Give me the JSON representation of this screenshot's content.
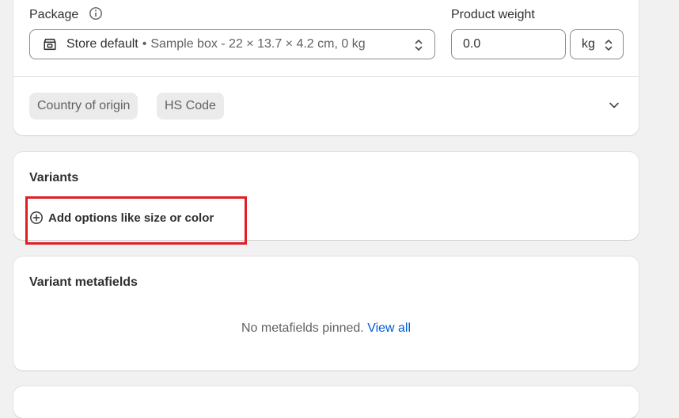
{
  "shipping": {
    "package_label": "Package",
    "package_select": {
      "main": "Store default",
      "separator": "•",
      "detail": "Sample box - 22 × 13.7 × 4.2 cm, 0 kg"
    },
    "weight_label": "Product weight",
    "weight_value": "0.0",
    "weight_unit": "kg",
    "chips": [
      "Country of origin",
      "HS Code"
    ]
  },
  "variants": {
    "title": "Variants",
    "add_options_label": "Add options like size or color"
  },
  "metafields": {
    "title": "Variant metafields",
    "empty_text": "No metafields pinned.",
    "view_all_label": "View all"
  },
  "colors": {
    "link": "#005bd3",
    "highlight": "#e01e26"
  },
  "icons": [
    "info-icon",
    "package-box-icon",
    "updown-arrows-icon",
    "chevron-down-icon",
    "plus-circle-icon"
  ]
}
